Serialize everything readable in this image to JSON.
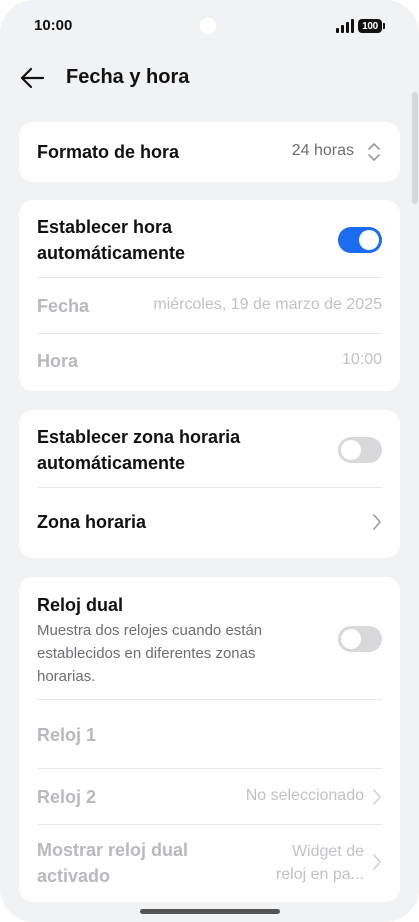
{
  "status_bar": {
    "time": "10:00",
    "battery": "100"
  },
  "header": {
    "title": "Fecha y hora"
  },
  "time_format": {
    "label": "Formato de hora",
    "value": "24 horas"
  },
  "auto_time": {
    "label": "Establecer hora automáticamente",
    "enabled": true,
    "date_label": "Fecha",
    "date_value": "miércoles, 19 de marzo de 2025",
    "time_label": "Hora",
    "time_value": "10:00"
  },
  "timezone": {
    "auto_label": "Establecer zona horaria automáticamente",
    "auto_enabled": false,
    "zone_label": "Zona horaria"
  },
  "dual_clock": {
    "title": "Reloj dual",
    "description": "Muestra dos relojes cuando están establecidos en diferentes zonas horarias.",
    "enabled": false,
    "clock1_label": "Reloj 1",
    "clock2_label": "Reloj 2",
    "clock2_value": "No seleccionado",
    "show_label": "Mostrar reloj dual activado",
    "show_value": "Widget de reloj en pa..."
  },
  "colors": {
    "accent": "#1a6cf0",
    "background": "#f1f2f4",
    "card": "#ffffff"
  }
}
